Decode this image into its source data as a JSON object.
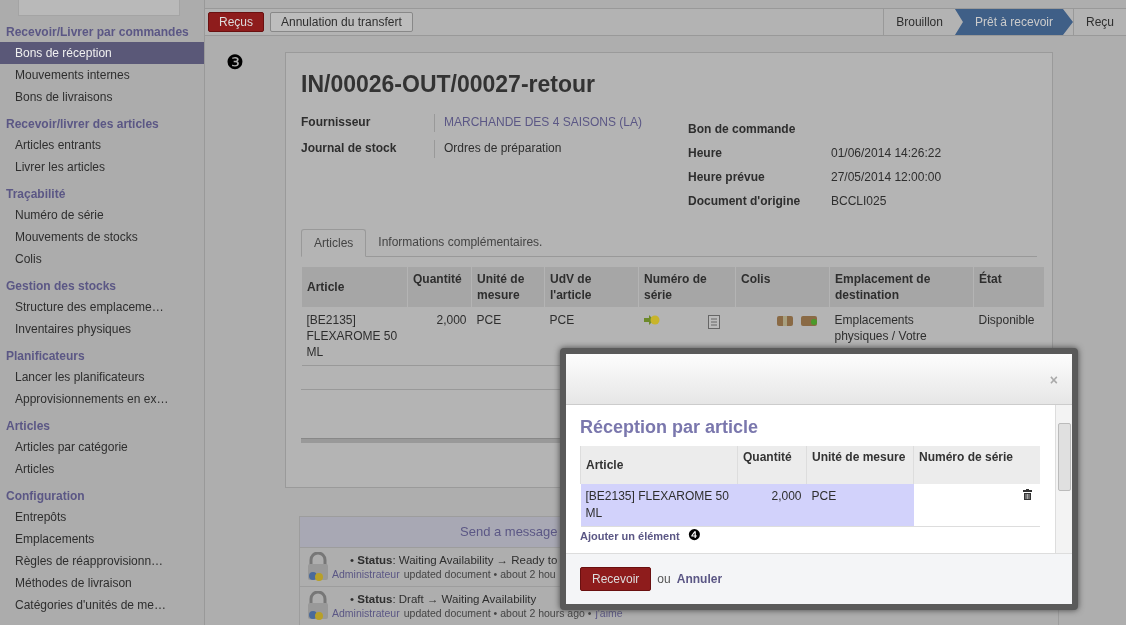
{
  "sidebar": {
    "sections": [
      {
        "title": "Recevoir/Livrer par commandes",
        "items": [
          {
            "label": "Bons de réception",
            "selected": true
          },
          {
            "label": "Mouvements internes",
            "selected": false
          },
          {
            "label": "Bons de livraisons",
            "selected": false
          }
        ]
      },
      {
        "title": "Recevoir/livrer des articles",
        "items": [
          {
            "label": "Articles entrants",
            "selected": false
          },
          {
            "label": "Livrer les articles",
            "selected": false
          }
        ]
      },
      {
        "title": "Traçabilité",
        "items": [
          {
            "label": "Numéro de série",
            "selected": false
          },
          {
            "label": "Mouvements de stocks",
            "selected": false
          },
          {
            "label": "Colis",
            "selected": false
          }
        ]
      },
      {
        "title": "Gestion des stocks",
        "items": [
          {
            "label": "Structure des emplaceme…",
            "selected": false
          },
          {
            "label": "Inventaires physiques",
            "selected": false
          }
        ]
      },
      {
        "title": "Planificateurs",
        "items": [
          {
            "label": "Lancer les planificateurs",
            "selected": false
          },
          {
            "label": "Approvisionnements en ex…",
            "selected": false
          }
        ]
      },
      {
        "title": "Articles",
        "items": [
          {
            "label": "Articles par catégorie",
            "selected": false
          },
          {
            "label": "Articles",
            "selected": false
          }
        ]
      },
      {
        "title": "Configuration",
        "items": [
          {
            "label": "Entrepôts",
            "selected": false
          },
          {
            "label": "Emplacements",
            "selected": false
          },
          {
            "label": "Règles de réapprovisionn…",
            "selected": false
          },
          {
            "label": "Méthodes de livraison",
            "selected": false
          },
          {
            "label": "Catégories d'unités de me…",
            "selected": false
          }
        ]
      }
    ]
  },
  "toolbar": {
    "buttons": [
      {
        "label": "Reçus",
        "kind": "primary"
      },
      {
        "label": "Annulation du transfert",
        "kind": "default"
      }
    ],
    "stages": [
      {
        "label": "Brouillon",
        "selected": false
      },
      {
        "label": "Prêt à recevoir",
        "selected": true
      },
      {
        "label": "Reçu",
        "selected": false
      }
    ]
  },
  "callouts": [
    "❸",
    "❹"
  ],
  "form": {
    "title": "IN/00026-OUT/00027-retour",
    "left_fields": [
      {
        "label": "Fournisseur",
        "value": "MARCHANDE DES 4 SAISONS (LA)",
        "kind": "link"
      },
      {
        "label": "Journal de stock",
        "value": "Ordres de préparation",
        "kind": "text"
      }
    ],
    "right_fields": [
      {
        "label": "Bon de commande"
      },
      {
        "label": "Heure",
        "value": "01/06/2014 14:26:22"
      },
      {
        "label": "Heure prévue",
        "value": "27/05/2014 12:00:00"
      },
      {
        "label": "Document d'origine",
        "value": "BCCLI025"
      }
    ],
    "tabs": [
      {
        "label": "Articles",
        "selected": true
      },
      {
        "label": "Informations complémentaires.",
        "selected": false
      }
    ],
    "table": {
      "columns": [
        "Article",
        "Quantité",
        "Unité de mesure",
        "UdV de l'article",
        "Numéro de série",
        "Colis",
        "Emplacement de destination",
        "État"
      ],
      "rows": [
        {
          "article": "[BE2135] FLEXAROME 50 ML",
          "quantity": "2,000",
          "uom": "PCE",
          "sale_uom": "PCE",
          "destination": "Emplacements physiques / Votre",
          "state": "Disponible"
        }
      ]
    }
  },
  "chatter": {
    "send_label": "Send a message",
    "messages": [
      {
        "text": "• **Status**: Waiting Availability → Ready to",
        "author": "Administrateur",
        "meta": "updated document • about 2 hou"
      },
      {
        "text": "• **Status**: Draft → Waiting Availability",
        "author": "Administrateur",
        "meta": "updated document • about 2 hours ago •",
        "like": "j'aime"
      }
    ]
  },
  "dialog": {
    "close": "×",
    "title": "Réception par article",
    "columns": [
      "Article",
      "Quantité",
      "Unité de mesure",
      "Numéro de série"
    ],
    "rows": [
      {
        "article": "[BE2135] FLEXAROME 50 ML",
        "quantity": "2,000",
        "uom": "PCE",
        "serial": "",
        "selected": true
      }
    ],
    "add_link": "Ajouter un élément",
    "confirm": "Recevoir",
    "or": "ou",
    "cancel": "Annuler"
  }
}
